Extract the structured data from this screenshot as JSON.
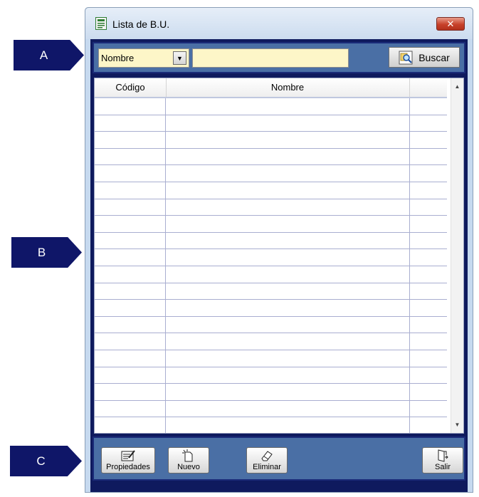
{
  "callouts": {
    "a": "A",
    "b": "B",
    "c": "C"
  },
  "window": {
    "title": "Lista de B.U.",
    "close_glyph": "✕"
  },
  "search": {
    "field_value": "Nombre",
    "arrow_glyph": "▼",
    "query": "",
    "button_label": "Buscar"
  },
  "table": {
    "columns": [
      "Código",
      "Nombre"
    ],
    "row_count": 20,
    "scroll_up_glyph": "▲",
    "scroll_down_glyph": "▼"
  },
  "toolbar": {
    "properties_label": "Propiedades",
    "new_label": "Nuevo",
    "delete_label": "Eliminar",
    "exit_label": "Salir"
  },
  "colors": {
    "callout": "#0f1668",
    "panel": "#4a6fa5",
    "frame": "#0f1a5e",
    "field": "#fdf6c8"
  }
}
